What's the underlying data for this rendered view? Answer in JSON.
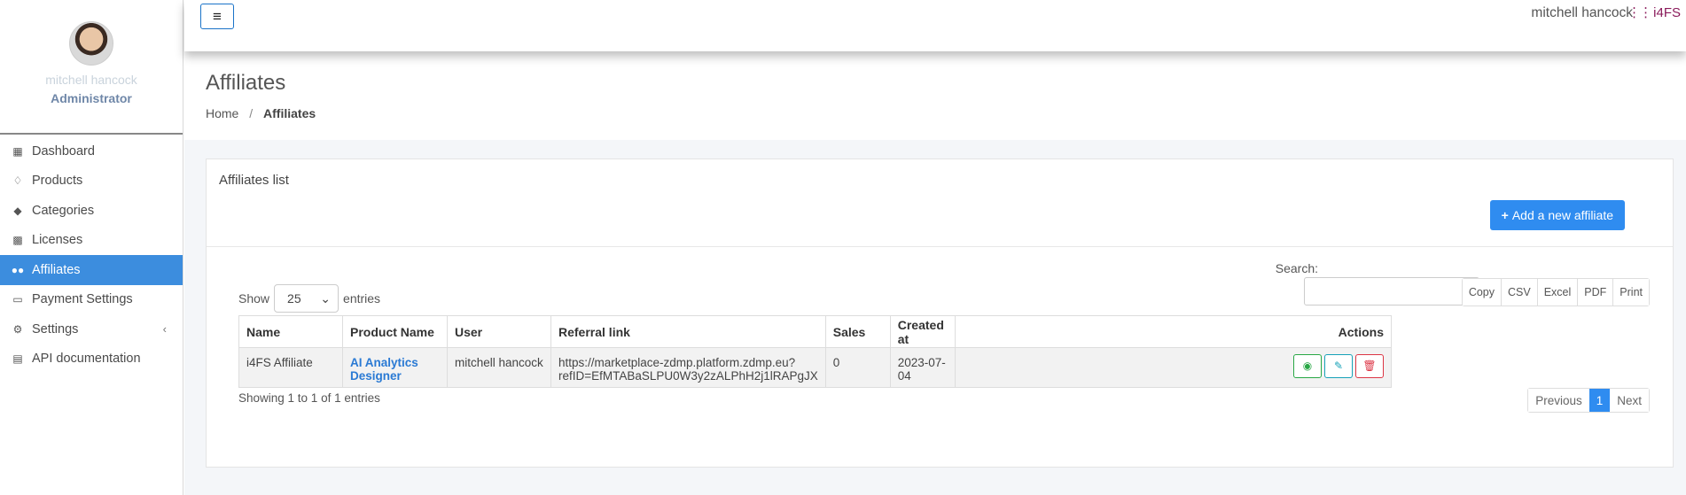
{
  "sidebar": {
    "user_name": "mitchell hancock",
    "user_role": "Administrator",
    "items": [
      {
        "label": "Dashboard",
        "icon": "dashboard-icon"
      },
      {
        "label": "Products",
        "icon": "diamond-icon"
      },
      {
        "label": "Categories",
        "icon": "tag-icon"
      },
      {
        "label": "Licenses",
        "icon": "id-badge-icon"
      },
      {
        "label": "Affiliates",
        "icon": "users-icon"
      },
      {
        "label": "Payment Settings",
        "icon": "credit-card-icon"
      },
      {
        "label": "Settings",
        "icon": "cogs-icon"
      },
      {
        "label": "API documentation",
        "icon": "book-icon"
      }
    ],
    "active": "Affiliates"
  },
  "topbar": {
    "toggle_icon": "≡",
    "user_name": "mitchell hancock",
    "brand": "i4FS"
  },
  "page": {
    "title": "Affiliates",
    "breadcrumb": {
      "home": "Home",
      "sep": "/",
      "current": "Affiliates"
    }
  },
  "card": {
    "title": "Affiliates list",
    "add_button": "Add a new affiliate"
  },
  "table_controls": {
    "show_label": "Show",
    "entries_value": "25",
    "entries_label": "entries",
    "search_label": "Search:",
    "search_value": "",
    "export_buttons": [
      "Copy",
      "CSV",
      "Excel",
      "PDF",
      "Print"
    ]
  },
  "table": {
    "headers": [
      "Name",
      "Product Name",
      "User",
      "Referral link",
      "Sales",
      "Created at",
      "Actions"
    ],
    "rows": [
      {
        "name": "i4FS Affiliate",
        "product_line1": "AI Analytics",
        "product_line2": "Designer",
        "user": "mitchell hancock",
        "link_line1": "https://marketplace-zdmp.platform.zdmp.eu?",
        "link_line2": "refID=EfMTABaSLPU0W3y2zALPhH2j1lRAPgJX",
        "sales": "0",
        "created_at": "2023-07-04"
      }
    ]
  },
  "footer": {
    "info": "Showing 1 to 1 of 1 entries",
    "prev": "Previous",
    "page": "1",
    "next": "Next"
  },
  "colors": {
    "accent": "#2f8cf0",
    "sidebar_active": "#3c8dde",
    "brand": "#8a1a5a"
  }
}
